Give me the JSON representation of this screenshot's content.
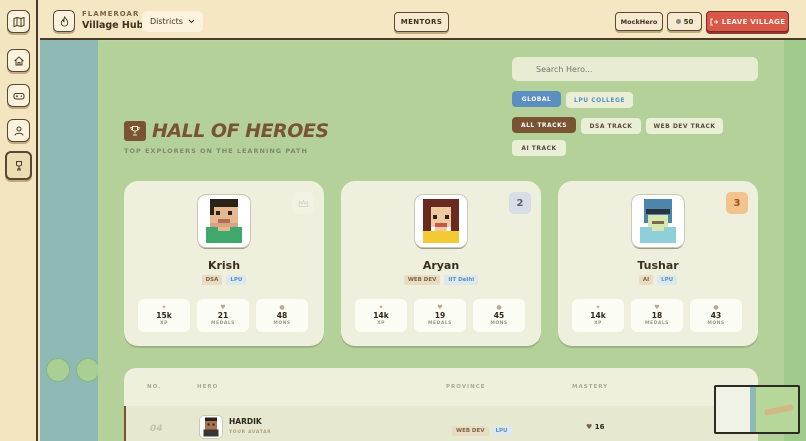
{
  "topbar": {
    "kicker": "FLAMEROAR",
    "title": "Village Hub",
    "districts_label": "Districts",
    "mentors_label": "MENTORS",
    "username": "MockHero",
    "coins": "50",
    "leave_label": "LEAVE VILLAGE"
  },
  "sidebar": {
    "items": [
      {
        "icon": "map-icon"
      },
      {
        "icon": "home-icon"
      },
      {
        "icon": "gamepad-icon"
      },
      {
        "icon": "user-icon"
      },
      {
        "icon": "trophy-icon"
      }
    ]
  },
  "search": {
    "placeholder": "Search Hero..."
  },
  "filters": {
    "scope": [
      {
        "label": "GLOBAL",
        "active": true
      },
      {
        "label": "LPU COLLEGE",
        "active": false
      }
    ],
    "tracks": [
      {
        "label": "ALL TRACKS",
        "active": true
      },
      {
        "label": "DSA TRACK",
        "active": false
      },
      {
        "label": "WEB DEV TRACK",
        "active": false
      },
      {
        "label": "AI TRACK",
        "active": false
      }
    ]
  },
  "hall": {
    "title": "HALL OF HEROES",
    "subtitle": "TOP EXPLORERS ON THE LEARNING PATH"
  },
  "podium": [
    {
      "name": "Krish",
      "rank": "",
      "track": "DSA",
      "college": "LPU",
      "xp": "15k",
      "medals": "21",
      "mons": "48",
      "badge_color": "#f1f2e4"
    },
    {
      "name": "Aryan",
      "rank": "2",
      "track": "WEB DEV",
      "college": "IIT Delhi",
      "xp": "14k",
      "medals": "19",
      "mons": "45",
      "badge_color": "#d9dde6"
    },
    {
      "name": "Tushar",
      "rank": "3",
      "track": "AI",
      "college": "LPU",
      "xp": "14k",
      "medals": "18",
      "mons": "43",
      "badge_color": "#f2c38d"
    }
  ],
  "stat_labels": {
    "xp": "XP",
    "medals": "MEDALS",
    "mons": "MONS"
  },
  "table": {
    "headers": [
      "NO.",
      "HERO",
      "PROVINCE",
      "MASTERY"
    ],
    "rows": [
      {
        "rank": "04",
        "name": "HARDIK",
        "sub": "YOUR AVATAR",
        "track": "WEB DEV",
        "college": "LPU",
        "mastery": "16"
      }
    ]
  },
  "colors": {
    "accent_brown": "#7a5332",
    "leave_red": "#d9584a",
    "global_blue": "#5b8fc0"
  }
}
